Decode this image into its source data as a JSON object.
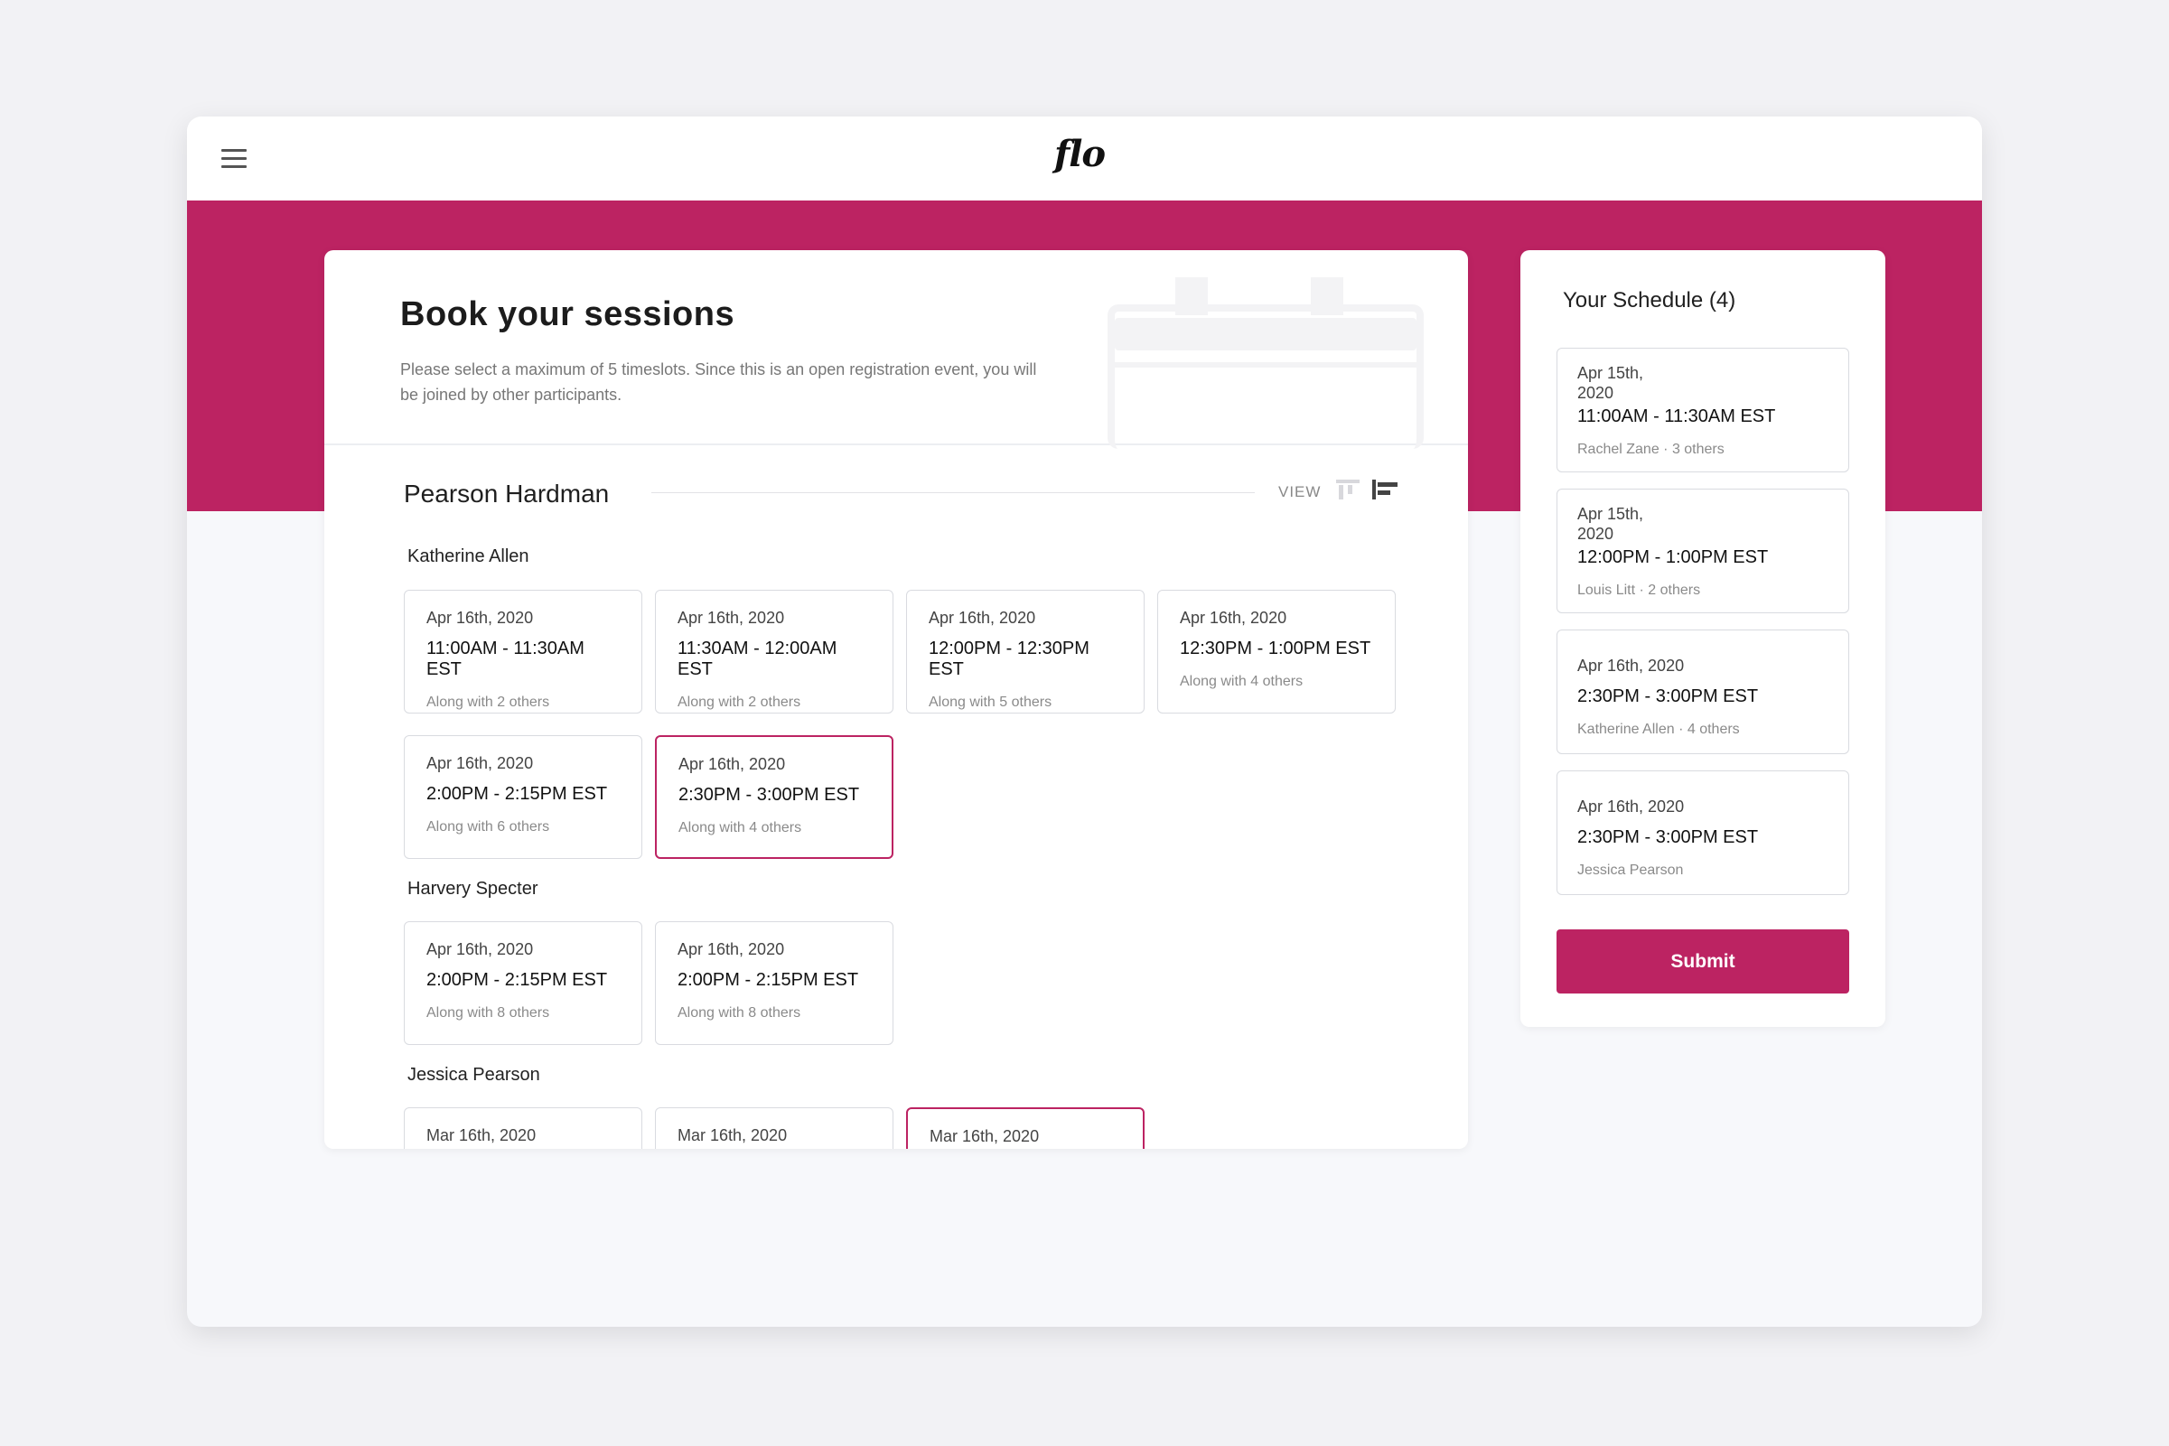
{
  "app": {
    "logo": "flo"
  },
  "colors": {
    "accent": "#bc2362",
    "background": "#f7f8fb"
  },
  "main": {
    "title": "Book your sessions",
    "subtitle": "Please select a maximum of 5 timeslots. Since this is an open registration event, you will be joined by other participants.",
    "section_title": "Pearson Hardman",
    "view_label": "VIEW",
    "groups": [
      {
        "person": "Katherine Allen",
        "slots": [
          {
            "date": "Apr 16th, 2020",
            "time": "11:00AM - 11:30AM EST",
            "others": "Along with 2 others",
            "selected": false
          },
          {
            "date": "Apr 16th, 2020",
            "time": "11:30AM - 12:00AM EST",
            "others": "Along with 2 others",
            "selected": false
          },
          {
            "date": "Apr 16th, 2020",
            "time": "12:00PM - 12:30PM EST",
            "others": "Along with 5 others",
            "selected": false
          },
          {
            "date": "Apr 16th, 2020",
            "time": "12:30PM - 1:00PM EST",
            "others": "Along with 4 others",
            "selected": false
          },
          {
            "date": "Apr 16th, 2020",
            "time": "2:00PM - 2:15PM EST",
            "others": "Along with 6 others",
            "selected": false
          },
          {
            "date": "Apr 16th, 2020",
            "time": "2:30PM - 3:00PM EST",
            "others": "Along with 4 others",
            "selected": true
          }
        ]
      },
      {
        "person": "Harvery Specter",
        "slots": [
          {
            "date": "Apr 16th, 2020",
            "time": "2:00PM - 2:15PM EST",
            "others": "Along with 8 others",
            "selected": false
          },
          {
            "date": "Apr 16th, 2020",
            "time": "2:00PM - 2:15PM EST",
            "others": "Along with 8 others",
            "selected": false
          }
        ]
      },
      {
        "person": "Jessica Pearson",
        "slots": [
          {
            "date": "Mar 16th, 2020",
            "selected": false
          },
          {
            "date": "Mar 16th, 2020",
            "selected": false
          },
          {
            "date": "Mar 16th, 2020",
            "selected": true
          }
        ]
      }
    ]
  },
  "schedule": {
    "title": "Your Schedule (4)",
    "items": [
      {
        "date_line1": "Apr 15th,",
        "date_line2": "2020",
        "time": "11:00AM - 11:30AM EST",
        "who": "Rachel Zane · 3 others"
      },
      {
        "date_line1": "Apr 15th,",
        "date_line2": "2020",
        "time": "12:00PM - 1:00PM EST",
        "who": "Louis Litt · 2 others"
      },
      {
        "date_line1": "Apr 16th, 2020",
        "time": "2:30PM - 3:00PM EST",
        "who": "Katherine Allen · 4 others"
      },
      {
        "date_line1": "Apr 16th, 2020",
        "time": "2:30PM - 3:00PM EST",
        "who": "Jessica Pearson"
      }
    ],
    "submit_label": "Submit"
  }
}
